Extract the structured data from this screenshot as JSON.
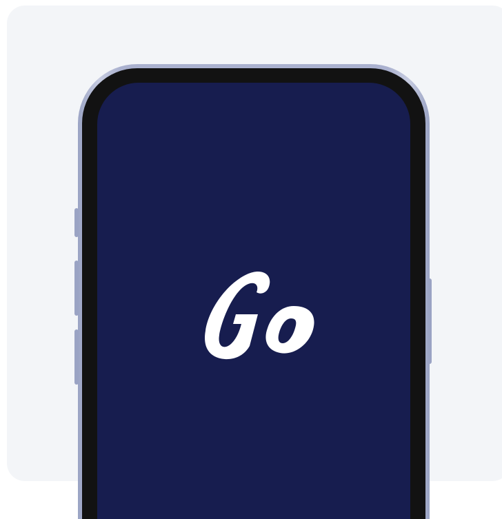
{
  "screen": {
    "background_color": "#171d4f",
    "logo_text": "Go",
    "logo_color": "#ffffff"
  },
  "frame": {
    "color": "#aab1cf",
    "bezel_color": "#121212"
  },
  "page": {
    "background_color": "#f3f5f8"
  }
}
